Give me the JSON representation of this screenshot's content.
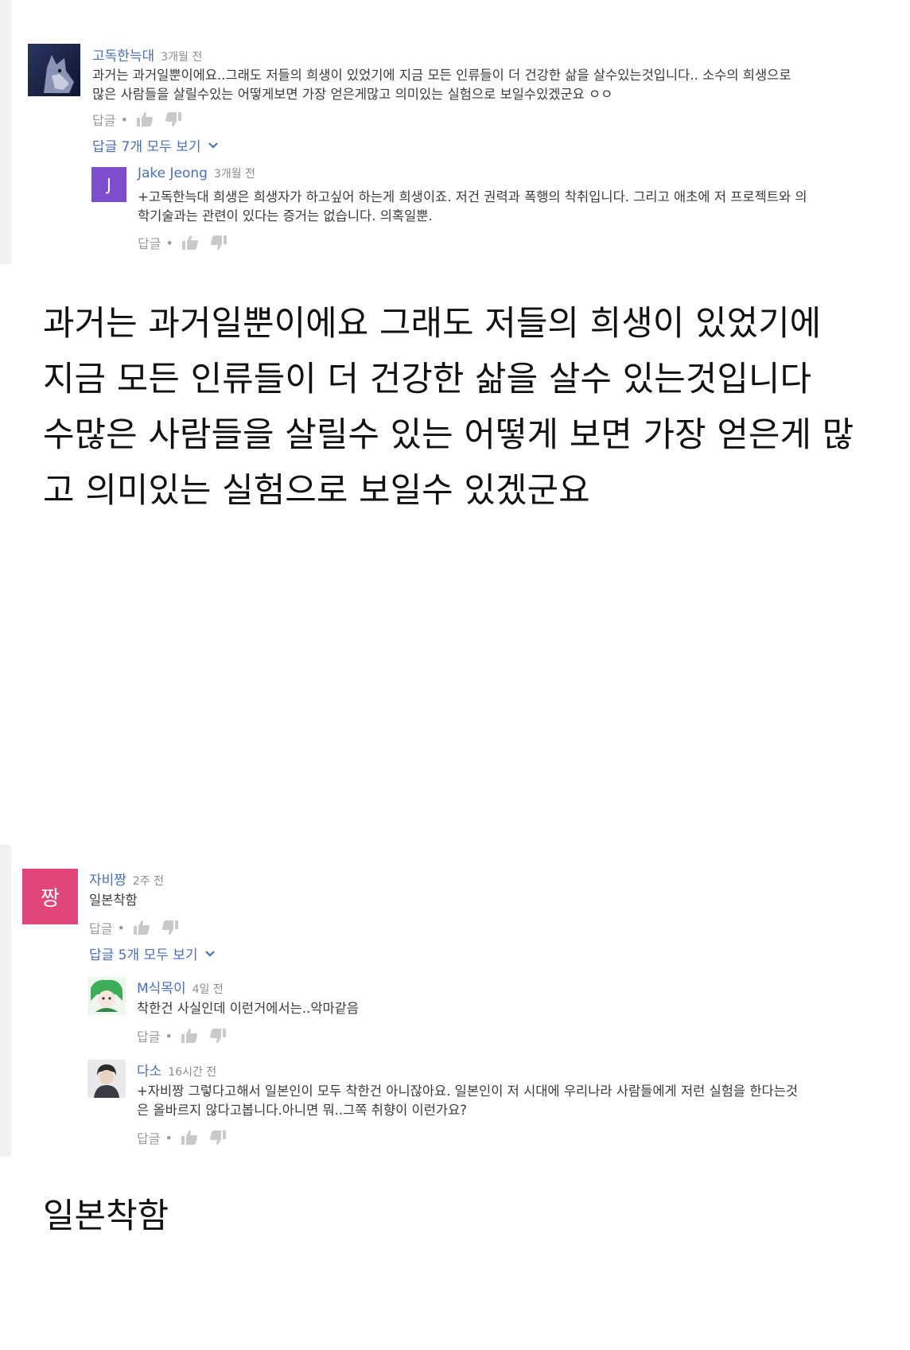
{
  "screenshot1": {
    "comment": {
      "author": "고독한늑대",
      "time": "3개월 전",
      "text": "과거는 과거일뿐이에요..그래도 저들의 희생이 있었기에 지금 모든 인류들이 더 건강한 삶을 살수있는것입니다.. 소수의 희생으로\n많은 사람들을 살릴수있는 어떻게보면 가장 얻은게많고 의미있는 실험으로 보일수있겠군요 ㅇㅇ",
      "reply_label": "답글",
      "view_replies": "답글 7개 모두 보기"
    },
    "reply": {
      "avatar_letter": "J",
      "author": "Jake Jeong",
      "time": "3개월 전",
      "text": "+고독한늑대 희생은 희생자가 하고싶어 하는게 희생이죠. 저건 권력과 폭행의 착취입니다. 그리고 애초에 저 프로젝트와 의\n학기술과는 관련이 있다는 증거는 없습니다. 의혹일뿐.",
      "reply_label": "답글"
    }
  },
  "caption1": "과거는 과거일뿐이에요 그래도 저들의 희생이 있었기에\n지금 모든 인류들이 더 건강한 삶을 살수 있는것입니다\n수많은 사람들을 살릴수 있는 어떻게 보면 가장 얻은게 많\n고 의미있는 실험으로 보일수 있겠군요",
  "screenshot2": {
    "comment": {
      "avatar_letter": "짱",
      "author": "자비짱",
      "time": "2주 전",
      "text": "일본착함",
      "reply_label": "답글",
      "view_replies": "답글 5개 모두 보기"
    },
    "reply1": {
      "author": "M식목이",
      "time": "4일 전",
      "text": "착한건 사실인데 이런거에서는..악마같음",
      "reply_label": "답글"
    },
    "reply2": {
      "author": "다소",
      "time": "16시간 전",
      "text": "+자비짱 그렇다고해서 일본인이 모두 착한건 아니잖아요. 일본인이 저 시대에 우리나라 사람들에게 저런 실험을 한다는것\n은 올바르지 않다고봅니다.아니면 뭐..그쪽 취향이 이런가요?",
      "reply_label": "답글"
    }
  },
  "caption2": "일본착함",
  "colors": {
    "link_blue": "#4a6fb3",
    "avatar_purple": "#7c4dcc",
    "avatar_pink": "#e0457b"
  }
}
